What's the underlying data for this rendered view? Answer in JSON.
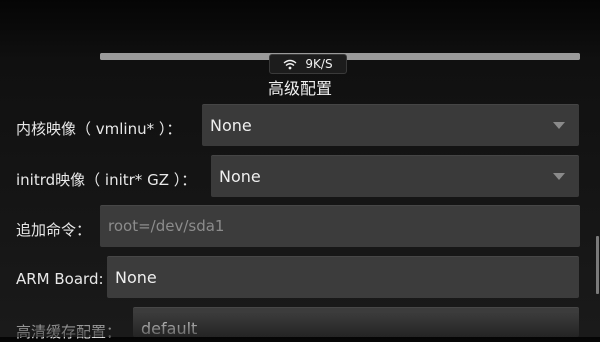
{
  "status": {
    "progress": 1.0,
    "net_speed": "9K/S",
    "wifi_icon": "wifi-icon"
  },
  "page": {
    "title": "高级配置"
  },
  "form": {
    "kernel_image": {
      "label": "内核映像（ vmlinu* ）：",
      "value": "None"
    },
    "initrd_image": {
      "label": "initrd映像（ initr* GZ ）：",
      "value": "None"
    },
    "extra_cmd": {
      "label": "追加命令：",
      "placeholder": "root=/dev/sda1"
    },
    "arm_board": {
      "label": "ARM Board:",
      "value": "None"
    },
    "hd_cache": {
      "label": "高清缓存配置：",
      "value": "default"
    }
  },
  "colors": {
    "field_bg": "#3a3a3a",
    "background": "#151515"
  }
}
